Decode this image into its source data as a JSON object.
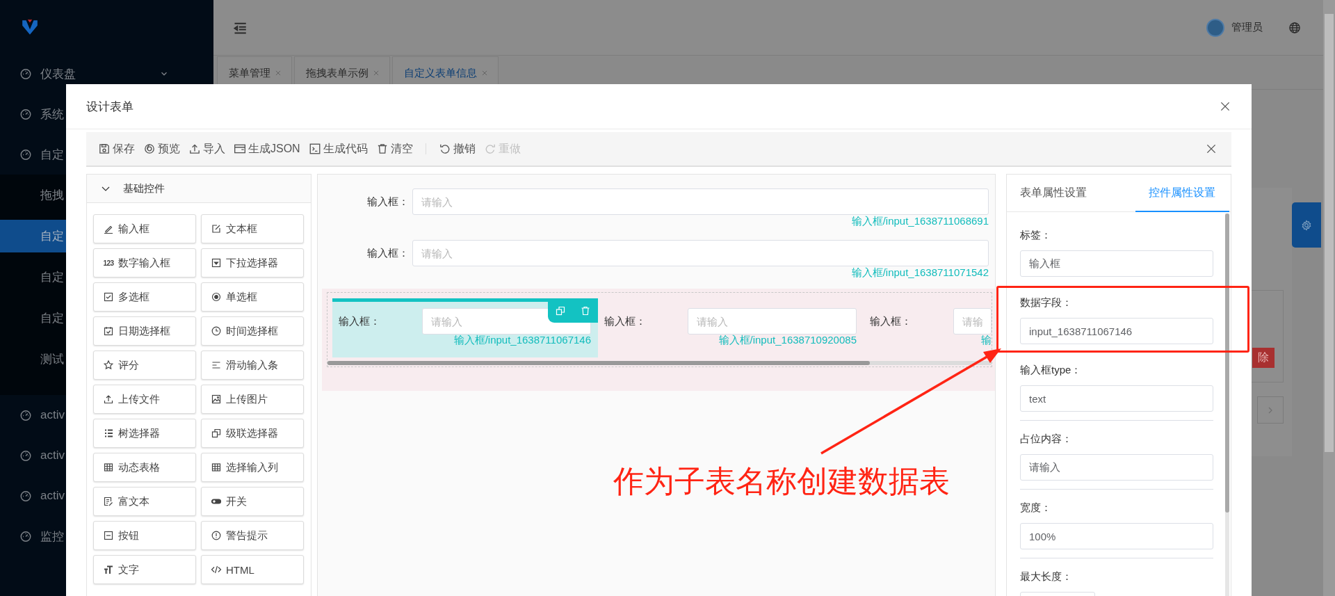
{
  "sidebar": {
    "items": [
      {
        "label": "仪表盘",
        "expanded": false
      },
      {
        "label": "系统"
      },
      {
        "label": "自定",
        "children": [
          {
            "label": "拖拽",
            "selected": false
          },
          {
            "label": "自定",
            "selected": true
          },
          {
            "label": "自定",
            "selected": false
          },
          {
            "label": "自定",
            "selected": false
          },
          {
            "label": "测试",
            "selected": false
          }
        ]
      },
      {
        "label": "activ"
      },
      {
        "label": "activ"
      },
      {
        "label": "activ"
      },
      {
        "label": "监控"
      }
    ]
  },
  "header": {
    "user": "管理员"
  },
  "tabs": [
    {
      "label": "菜单管理",
      "selected": false
    },
    {
      "label": "拖拽表单示例",
      "selected": false
    },
    {
      "label": "自定义表单信息",
      "selected": true
    }
  ],
  "background": {
    "delete_button": "除"
  },
  "dialog": {
    "title": "设计表单",
    "toolbar": [
      {
        "label": "保存",
        "kind": "save",
        "disabled": false
      },
      {
        "label": "预览",
        "kind": "preview",
        "disabled": false
      },
      {
        "label": "导入",
        "kind": "upload",
        "disabled": false
      },
      {
        "label": "生成JSON",
        "kind": "window",
        "disabled": false
      },
      {
        "label": "生成代码",
        "kind": "terminal",
        "disabled": false
      },
      {
        "label": "清空",
        "kind": "trash",
        "disabled": false
      },
      {
        "label": "撤销",
        "kind": "undo",
        "disabled": false,
        "separator_before": true
      },
      {
        "label": "重做",
        "kind": "redo",
        "disabled": true
      }
    ],
    "widget_group": {
      "title": "基础控件",
      "expanded": true,
      "widgets": [
        {
          "label": "输入框",
          "kind": "pencil"
        },
        {
          "label": "文本框",
          "kind": "edit"
        },
        {
          "label": "数字输入框",
          "kind": "glyph",
          "glyph": "123"
        },
        {
          "label": "下拉选择器",
          "kind": "dropdown"
        },
        {
          "label": "多选框",
          "kind": "checkbox"
        },
        {
          "label": "单选框",
          "kind": "radio"
        },
        {
          "label": "日期选择框",
          "kind": "calendar"
        },
        {
          "label": "时间选择框",
          "kind": "clock"
        },
        {
          "label": "评分",
          "kind": "star"
        },
        {
          "label": "滑动输入条",
          "kind": "lines"
        },
        {
          "label": "上传文件",
          "kind": "upload"
        },
        {
          "label": "上传图片",
          "kind": "image"
        },
        {
          "label": "树选择器",
          "kind": "tree"
        },
        {
          "label": "级联选择器",
          "kind": "copy"
        },
        {
          "label": "动态表格",
          "kind": "table"
        },
        {
          "label": "选择输入列",
          "kind": "table"
        },
        {
          "label": "富文本",
          "kind": "doc"
        },
        {
          "label": "开关",
          "kind": "switch"
        },
        {
          "label": "按钮",
          "kind": "minus-box"
        },
        {
          "label": "警告提示",
          "kind": "alert"
        },
        {
          "label": "文字",
          "kind": "text-size"
        },
        {
          "label": "HTML",
          "kind": "code"
        }
      ]
    },
    "canvas": {
      "fields": [
        {
          "label": "输入框：",
          "placeholder": "请输入",
          "caption": "输入框/input_1638711068691"
        },
        {
          "label": "输入框：",
          "placeholder": "请输入",
          "caption": "输入框/input_1638711071542"
        }
      ],
      "grid": {
        "columns": [
          {
            "label": "输入框：",
            "placeholder": "请输入",
            "caption": "输入框/input_1638711067146",
            "selected": true
          },
          {
            "label": "输入框：",
            "placeholder": "请输入",
            "caption": "输入框/input_1638710920085",
            "selected": false
          },
          {
            "label": "输入框：",
            "placeholder": "请输",
            "caption": "输",
            "selected": false
          }
        ]
      }
    },
    "properties": {
      "tabs": [
        {
          "label": "表单属性设置",
          "selected": false
        },
        {
          "label": "控件属性设置",
          "selected": true
        }
      ],
      "fields": [
        {
          "kind": "full",
          "label": "标签：",
          "value": "输入框",
          "divider": false
        },
        {
          "kind": "full",
          "label": "数据字段：",
          "value": "input_1638711067146",
          "divider": false
        },
        {
          "kind": "full",
          "label": "输入框type：",
          "value": "text",
          "divider": true
        },
        {
          "kind": "full",
          "label": "占位内容：",
          "value": "请输入",
          "divider": true
        },
        {
          "kind": "full",
          "label": "宽度：",
          "value": "100%",
          "divider": true
        },
        {
          "kind": "short",
          "label": "最大长度：",
          "divider": false
        }
      ]
    }
  },
  "annotation": {
    "text": "作为子表名称创建数据表"
  }
}
